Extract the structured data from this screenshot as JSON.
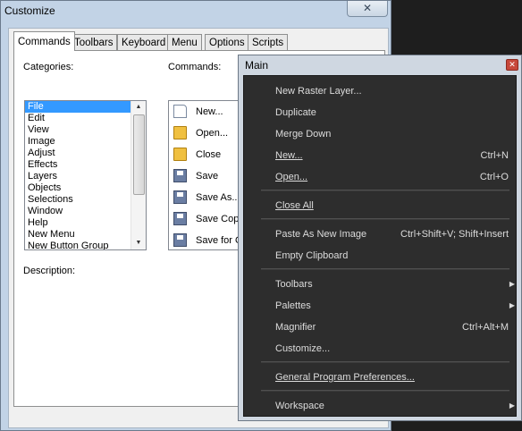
{
  "dialog": {
    "title": "Customize",
    "close_glyph": "✕",
    "tabs": [
      "Commands",
      "Toolbars",
      "Keyboard",
      "Menu",
      "Options",
      "Scripts"
    ],
    "categories_label": "Categories:",
    "commands_label": "Commands:",
    "description_label": "Description:",
    "categories": [
      "File",
      "Edit",
      "View",
      "Image",
      "Adjust",
      "Effects",
      "Layers",
      "Objects",
      "Selections",
      "Window",
      "Help",
      "New Menu",
      "New Button Group"
    ],
    "selected_category": "File",
    "commands": [
      {
        "label": "New...",
        "icon": "new-document-icon"
      },
      {
        "label": "Open...",
        "icon": "open-folder-icon"
      },
      {
        "label": "Close",
        "icon": "close-folder-icon"
      },
      {
        "label": "Save",
        "icon": "save-disk-icon"
      },
      {
        "label": "Save As...",
        "icon": "save-as-icon"
      },
      {
        "label": "Save Copy",
        "icon": "save-copy-icon"
      },
      {
        "label": "Save for O",
        "icon": "save-for-office-icon"
      }
    ]
  },
  "menu": {
    "title": "Main",
    "close_glyph": "✕",
    "items": [
      {
        "label": "New Raster Layer...",
        "shortcut": ""
      },
      {
        "label": "Duplicate",
        "shortcut": ""
      },
      {
        "label": "Merge Down",
        "shortcut": ""
      },
      {
        "label": "New...",
        "shortcut": "Ctrl+N"
      },
      {
        "label": "Open...",
        "shortcut": "Ctrl+O"
      },
      {
        "label": "Close All",
        "shortcut": ""
      },
      {
        "label": "Paste As New Image",
        "shortcut": "Ctrl+Shift+V; Shift+Insert"
      },
      {
        "label": "Empty Clipboard",
        "shortcut": ""
      },
      {
        "label": "Toolbars",
        "shortcut": "",
        "submenu": true
      },
      {
        "label": "Palettes",
        "shortcut": "",
        "submenu": true
      },
      {
        "label": "Magnifier",
        "shortcut": "Ctrl+Alt+M"
      },
      {
        "label": "Customize...",
        "shortcut": ""
      },
      {
        "label": "General Program Preferences...",
        "shortcut": ""
      },
      {
        "label": "Workspace",
        "shortcut": "",
        "submenu": true
      }
    ]
  }
}
